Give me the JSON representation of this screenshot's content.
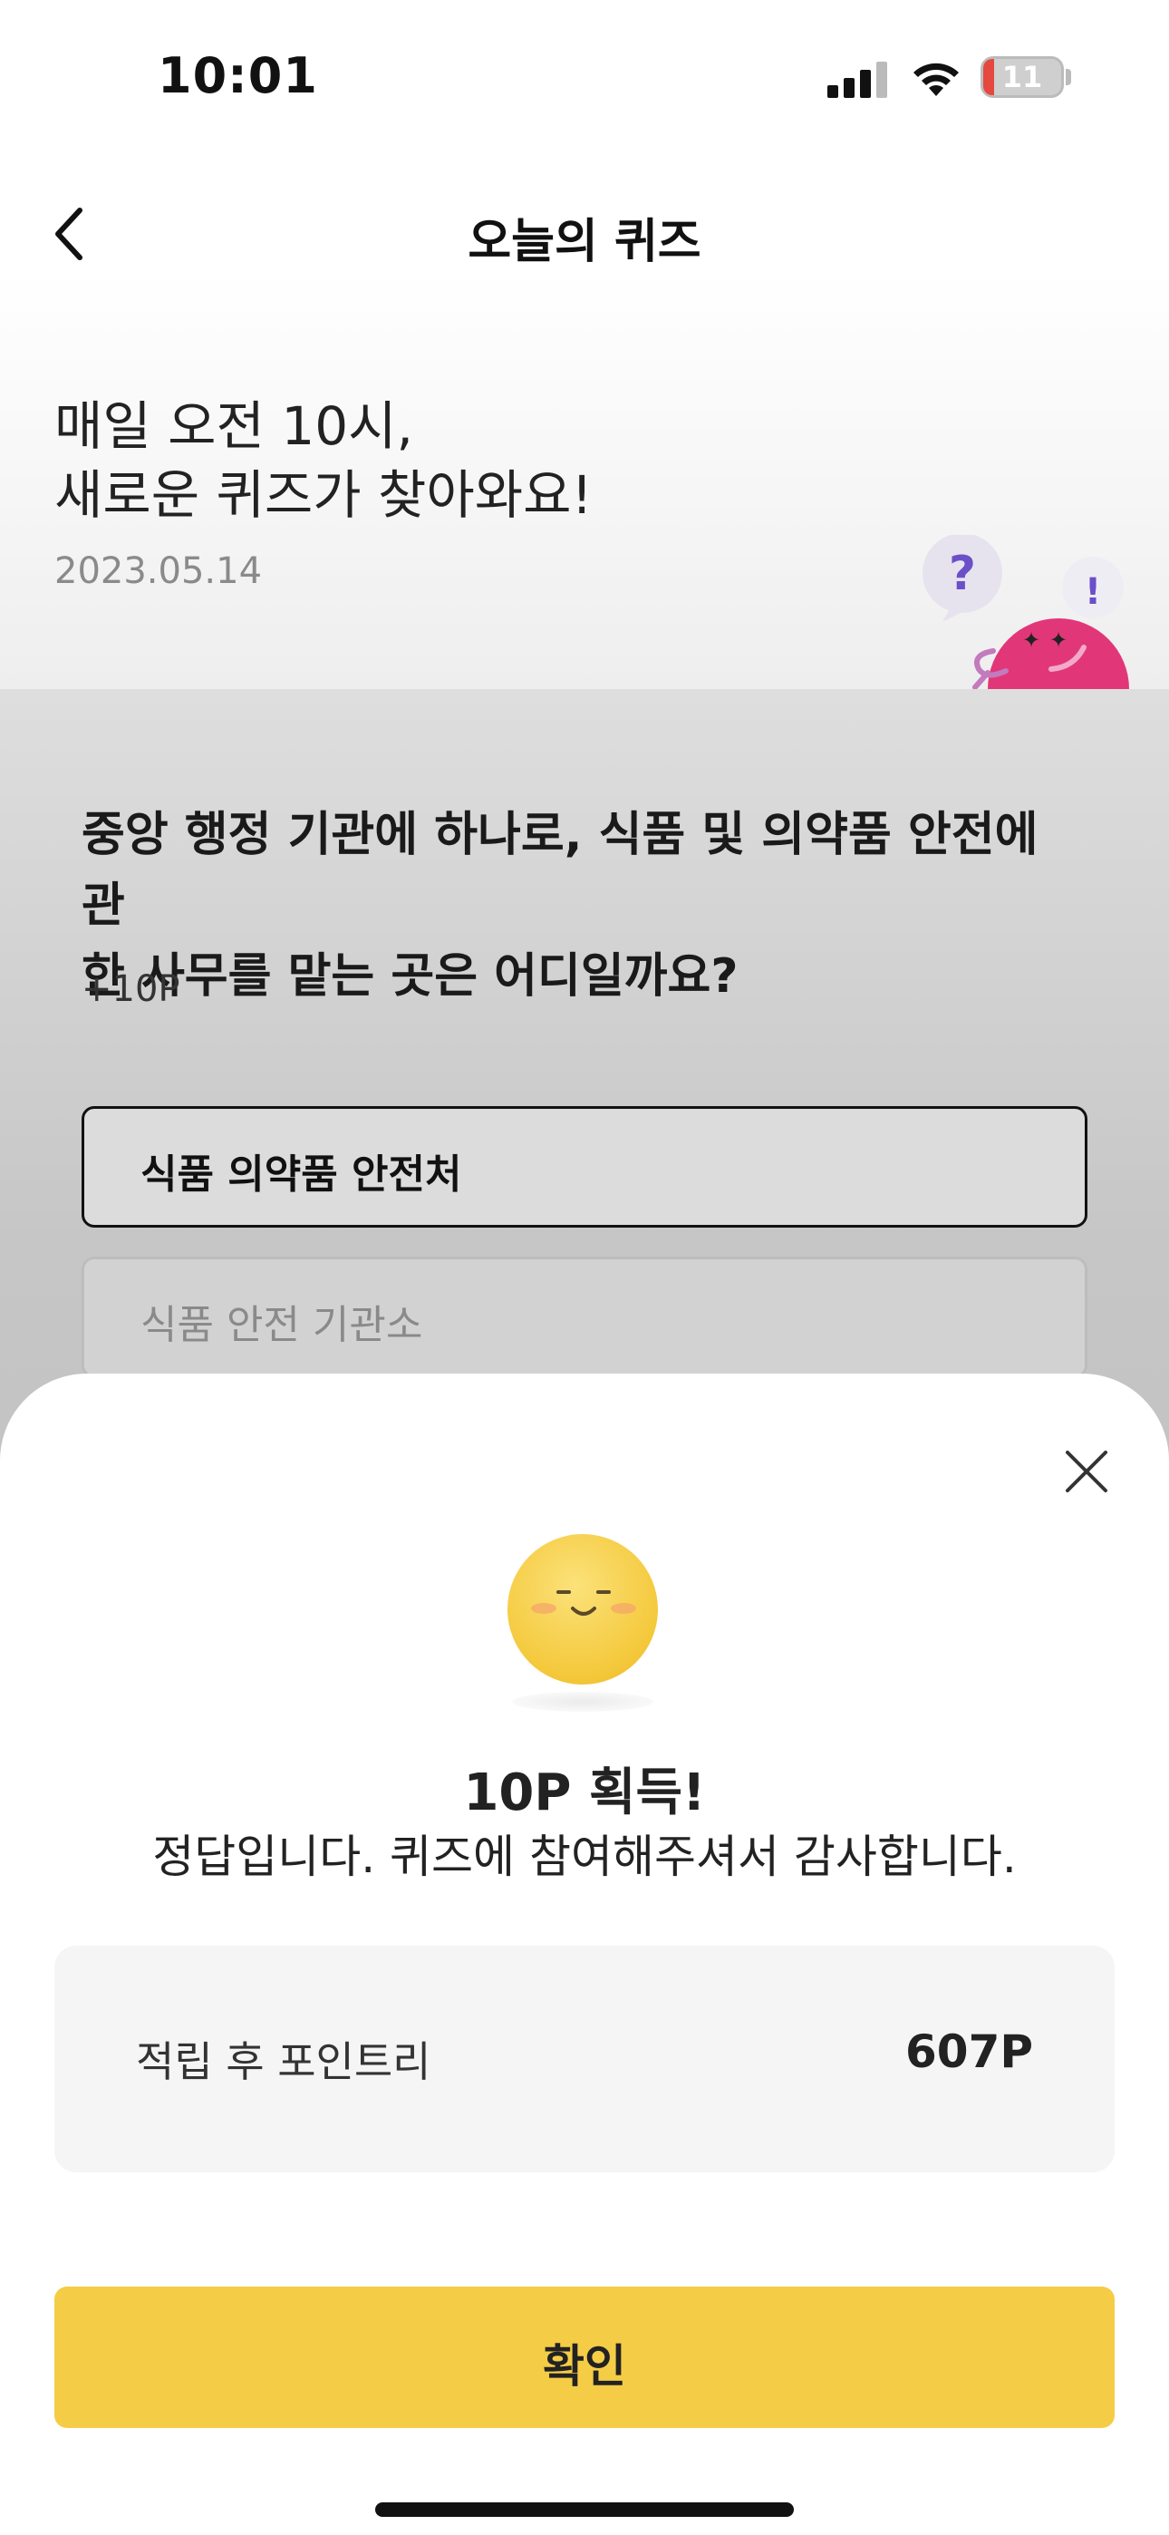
{
  "status_bar": {
    "time": "10:01",
    "battery": "11",
    "battery_low_color": "#e5483e"
  },
  "nav": {
    "title": "오늘의 퀴즈",
    "back_icon": "chevron-left-icon"
  },
  "header": {
    "headline_line1": "매일 오전 10시,",
    "headline_line2": "새로운 퀴즈가 찾아와요!",
    "date": "2023.05.14"
  },
  "quiz": {
    "question_line1": "중앙 행정 기관에 하나로, 식품 및 의약품 안전에 관",
    "question_line2": "한 사무를 맡는 곳은 어디일까요?",
    "points": "+10P",
    "options": [
      {
        "label": "식품 의약품 안전처",
        "selected": true
      },
      {
        "label": "식품 안전 기관소",
        "selected": false
      }
    ]
  },
  "result_sheet": {
    "title": "10P 획득!",
    "description": "정답입니다. 퀴즈에 참여해주셔서 감사합니다.",
    "points_label": "적립 후 포인트리",
    "points_value": "607P",
    "confirm_label": "확인",
    "close_icon": "close-icon",
    "accent_color": "#f5cc45"
  }
}
